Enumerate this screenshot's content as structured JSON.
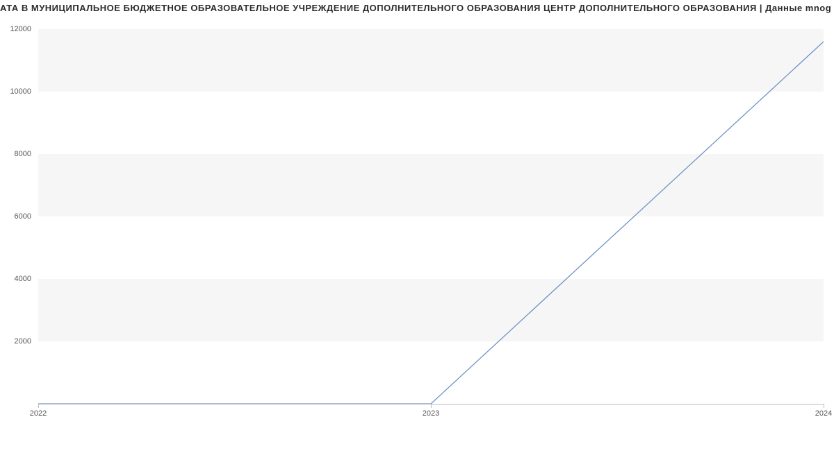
{
  "chart_data": {
    "type": "line",
    "title": "АТА В МУНИЦИПАЛЬНОЕ БЮДЖЕТНОЕ ОБРАЗОВАТЕЛЬНОЕ УЧРЕЖДЕНИЕ ДОПОЛНИТЕЛЬНОГО ОБРАЗОВАНИЯ ЦЕНТР ДОПОЛНИТЕЛЬНОГО ОБРАЗОВАНИЯ | Данные mnog",
    "xlabel": "",
    "ylabel": "",
    "x": [
      2022,
      2023,
      2024
    ],
    "series": [
      {
        "name": "",
        "values": [
          0,
          0,
          11600
        ]
      }
    ],
    "y_ticks": [
      2000,
      4000,
      6000,
      8000,
      10000,
      12000
    ],
    "x_ticks": [
      2022,
      2023,
      2024
    ],
    "ylim": [
      0,
      12000
    ],
    "xlim": [
      2022,
      2024
    ]
  },
  "colors": {
    "line": "#6f93c8",
    "band": "#f6f6f6"
  }
}
